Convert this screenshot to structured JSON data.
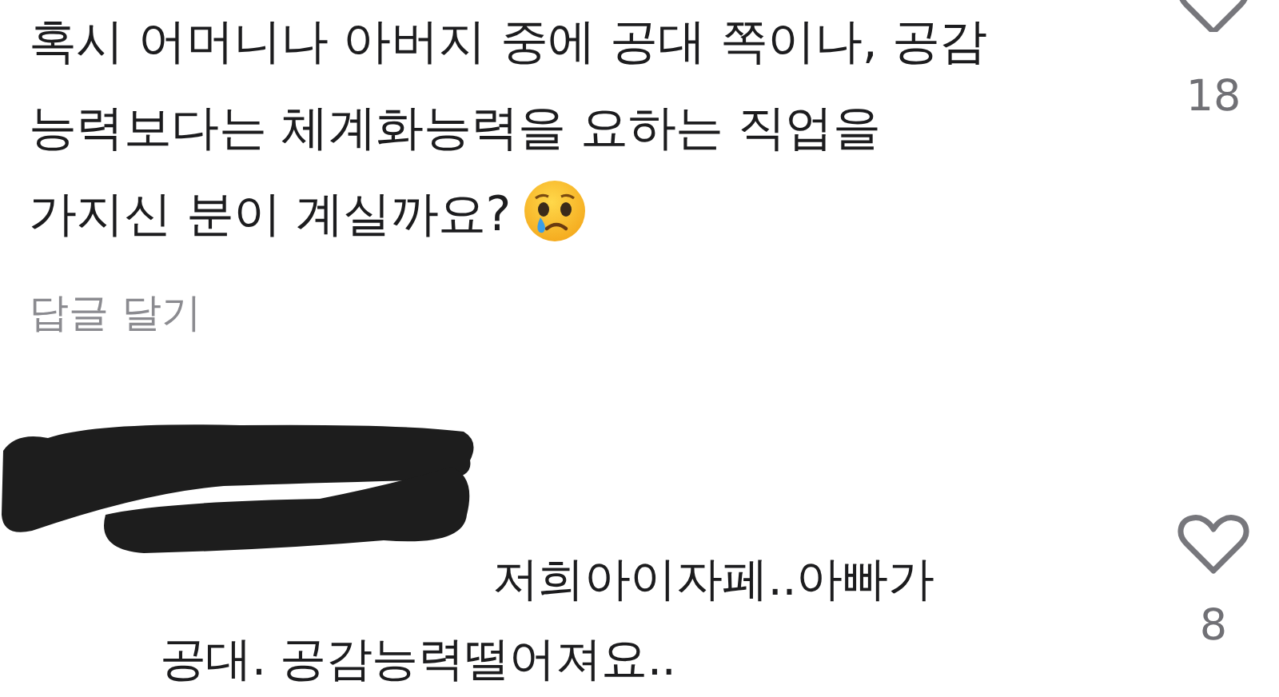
{
  "comments": [
    {
      "lines": [
        "혹시 어머니나 아버지 중에 공대 쪽이나, 공감",
        "능력보다는 체계화능력을 요하는 직업을",
        "가지신 분이 계실까요?"
      ],
      "emoji": true,
      "reply": "답글 달기",
      "liked": false,
      "likes": "18",
      "redacted": false
    },
    {
      "lines": [
        "저희아이자페..아빠가",
        "공대. 공감능력떨어져요.."
      ],
      "emoji": false,
      "liked": false,
      "likes": "8",
      "redacted": true
    }
  ]
}
